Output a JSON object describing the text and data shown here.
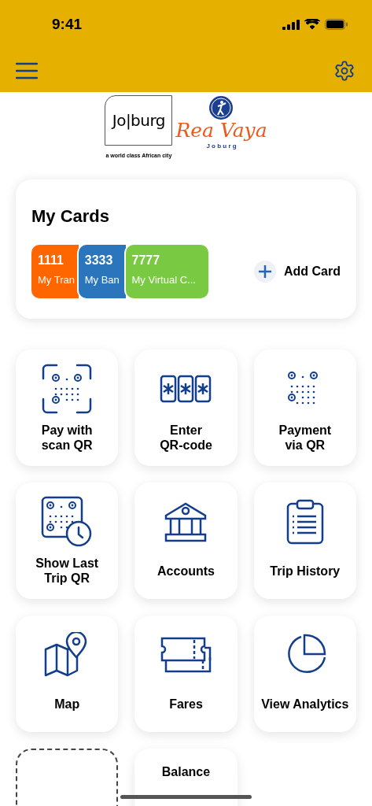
{
  "status_bar": {
    "time": "9:41"
  },
  "logos": {
    "city_name": "Jo|burg",
    "city_tagline": "a world class African city",
    "brand_name": "Rea Vaya",
    "brand_sub": "J o b u r g"
  },
  "my_cards": {
    "title": "My Cards",
    "add_label": "Add Card",
    "cards": [
      {
        "number": "1111",
        "name": "My Tran",
        "color": "#ff6600"
      },
      {
        "number": "3333",
        "name": "My Ban",
        "color": "#2a75bb"
      },
      {
        "number": "7777",
        "name": "My Virtual C...",
        "color": "#7ac943"
      }
    ]
  },
  "tiles": [
    {
      "kind": "action",
      "label": [
        "Pay with",
        "scan QR"
      ]
    },
    {
      "kind": "action",
      "label": [
        "Enter",
        "QR-code"
      ]
    },
    {
      "kind": "action",
      "label": [
        "Payment",
        "via QR"
      ]
    },
    {
      "kind": "action",
      "label": [
        "Show Last",
        "Trip QR"
      ]
    },
    {
      "kind": "action",
      "label": [
        "Accounts"
      ]
    },
    {
      "kind": "action",
      "label": [
        "Trip History"
      ]
    },
    {
      "kind": "action",
      "label": [
        "Map"
      ]
    },
    {
      "kind": "action",
      "label": [
        "Fares"
      ]
    },
    {
      "kind": "action",
      "label": [
        "View Analytics"
      ]
    },
    {
      "kind": "placeholder"
    },
    {
      "kind": "balance",
      "label": "Balance"
    }
  ]
}
